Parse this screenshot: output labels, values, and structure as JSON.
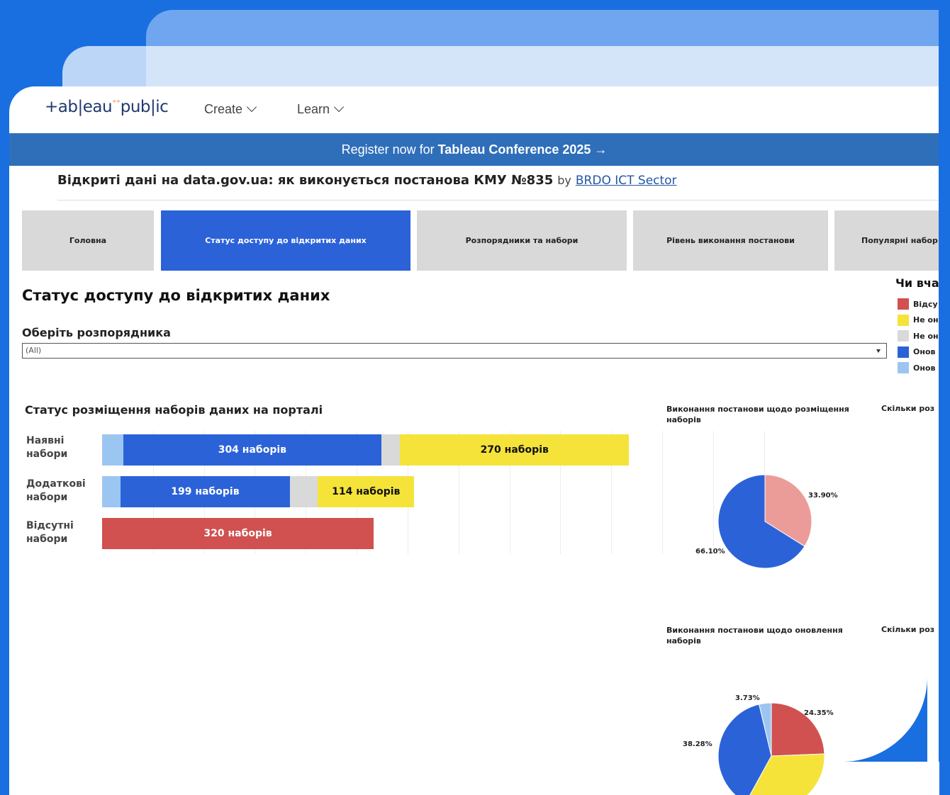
{
  "nav": {
    "logo": "+ableau public",
    "logo_prefix": "+ab|eau",
    "logo_suffix": "pub|ic",
    "create": "Create",
    "learn": "Learn"
  },
  "banner": {
    "text": "Register now for",
    "bold": "Tableau Conference 2025 →"
  },
  "viz": {
    "title": "Відкриті дані на data.gov.ua: як виконується постанова КМУ №835",
    "by": "by",
    "author": "BRDO ICT Sector"
  },
  "tabs": [
    {
      "label": "Головна",
      "active": false
    },
    {
      "label": "Статус доступу до відкритих даних",
      "active": true
    },
    {
      "label": "Розпорядники та набори",
      "active": false
    },
    {
      "label": "Рівень виконання постанови",
      "active": false
    },
    {
      "label": "Популярні набор",
      "active": false
    }
  ],
  "page_heading": "Статус доступу до відкритих даних",
  "legend": {
    "title": "Чи вча",
    "items": [
      {
        "label": "Відсу",
        "color": "#d05150"
      },
      {
        "label": "Не он",
        "color": "#f5e33a"
      },
      {
        "label": "Не он",
        "color": "#d9d9d9"
      },
      {
        "label": "Онов",
        "color": "#2b62d8"
      },
      {
        "label": "Онов",
        "color": "#9cc6f2"
      }
    ]
  },
  "filter": {
    "label": "Оберіть розпорядника",
    "value": "(All)"
  },
  "bar_section_title": "Статус розміщення наборів даних на порталі",
  "pie1_title": "Виконання постанови щодо розміщення наборів",
  "pie1_side_title": "Скільки роз",
  "pie2_title": "Виконання постанови щодо оновлення наборів",
  "pie2_side_title": "Скільки роз",
  "colors": {
    "red": "#d05150",
    "yellow": "#f5e33a",
    "grey": "#d9d9d9",
    "blue": "#2b62d8",
    "lightblue": "#9cc6f2",
    "pink": "#ec9c98"
  },
  "chart_data": [
    {
      "type": "bar",
      "title": "Статус розміщення наборів даних на порталі",
      "orientation": "horizontal",
      "stacked": true,
      "categories": [
        "Наявні набори",
        "Додаткові набори",
        "Відсутні набори"
      ],
      "series": [
        {
          "name": "Оновлені (light blue)",
          "color": "#9cc6f2",
          "values": [
            25,
            22,
            0
          ]
        },
        {
          "name": "Оновлені (blue)",
          "color": "#2b62d8",
          "values": [
            304,
            199,
            0
          ]
        },
        {
          "name": "Не оновлені (grey)",
          "color": "#d9d9d9",
          "values": [
            22,
            33,
            0
          ]
        },
        {
          "name": "Не оновлені (yellow)",
          "color": "#f5e33a",
          "values": [
            270,
            114,
            0
          ]
        },
        {
          "name": "Відсутні",
          "color": "#d05150",
          "values": [
            0,
            0,
            320
          ]
        }
      ],
      "labels": [
        [
          "",
          "304 наборів",
          "",
          "270 наборів",
          ""
        ],
        [
          "",
          "199 наборів",
          "",
          "114 наборів",
          ""
        ],
        [
          "",
          "",
          "",
          "",
          "320 наборів"
        ]
      ],
      "xlim": [
        0,
        660
      ]
    },
    {
      "type": "pie",
      "title": "Виконання постанови щодо розміщення наборів",
      "slices": [
        {
          "label": "33.90%",
          "value": 33.9,
          "color": "#ec9c98"
        },
        {
          "label": "66.10%",
          "value": 66.1,
          "color": "#2b62d8"
        }
      ]
    },
    {
      "type": "pie",
      "title": "Виконання постанови щодо оновлення наборів",
      "slices": [
        {
          "label": "3.73%",
          "value": 3.73,
          "color": "#9cc6f2"
        },
        {
          "label": "24.35%",
          "value": 24.35,
          "color": "#d05150"
        },
        {
          "label": "",
          "value": 33.64,
          "color": "#f5e33a"
        },
        {
          "label": "38.28%",
          "value": 38.28,
          "color": "#2b62d8"
        }
      ]
    }
  ]
}
